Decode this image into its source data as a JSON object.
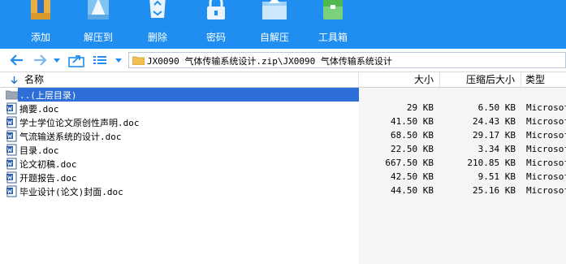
{
  "toolbar": {
    "buttons": [
      {
        "label": "添加",
        "icon": "add-archive-icon"
      },
      {
        "label": "解压到",
        "icon": "extract-to-icon"
      },
      {
        "label": "删除",
        "icon": "recycle-bin-icon"
      },
      {
        "label": "密码",
        "icon": "lock-icon"
      },
      {
        "label": "自解压",
        "icon": "self-extract-icon"
      },
      {
        "label": "工具箱",
        "icon": "toolbox-icon"
      }
    ],
    "bg_color": "#1f8ef0"
  },
  "address": {
    "path": "JX0090 气体传输系统设计.zip\\JX0090 气体传输系统设计"
  },
  "columns": {
    "name": "名称",
    "size": "大小",
    "compressed": "压缩后大小",
    "type": "类型"
  },
  "rows": [
    {
      "name": "..(上层目录)",
      "size": "",
      "compressed": "",
      "type": "",
      "selected": true,
      "icon": "folder-icon"
    },
    {
      "name": "摘要.doc",
      "size": "29 KB",
      "compressed": "6.50 KB",
      "type": "Microsof",
      "icon": "word-doc-icon"
    },
    {
      "name": "学士学位论文原创性声明.doc",
      "size": "41.50 KB",
      "compressed": "24.43 KB",
      "type": "Microsof",
      "icon": "word-doc-icon"
    },
    {
      "name": "气流输送系统的设计.doc",
      "size": "68.50 KB",
      "compressed": "29.17 KB",
      "type": "Microsof",
      "icon": "word-doc-icon"
    },
    {
      "name": "目录.doc",
      "size": "22.50 KB",
      "compressed": "3.34 KB",
      "type": "Microsof",
      "icon": "word-doc-icon"
    },
    {
      "name": "论文初稿.doc",
      "size": "667.50 KB",
      "compressed": "210.85 KB",
      "type": "Microsof",
      "icon": "word-doc-icon"
    },
    {
      "name": "开题报告.doc",
      "size": "42.50 KB",
      "compressed": "9.51 KB",
      "type": "Microsof",
      "icon": "word-doc-icon"
    },
    {
      "name": "毕业设计(论文)封面.doc",
      "size": "44.50 KB",
      "compressed": "25.16 KB",
      "type": "Microsof",
      "icon": "word-doc-icon"
    }
  ],
  "colors": {
    "selection": "#2d6fd6",
    "accent": "#1f8ef0"
  }
}
